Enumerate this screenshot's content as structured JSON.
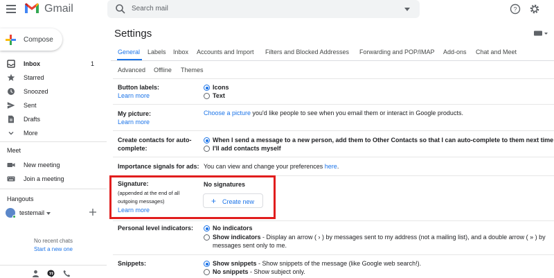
{
  "app": {
    "brand": "Gmail"
  },
  "search": {
    "placeholder": "Search mail"
  },
  "compose": {
    "label": "Compose"
  },
  "sidebar": {
    "items": [
      {
        "label": "Inbox",
        "count": "1",
        "icon": "inbox-icon"
      },
      {
        "label": "Starred",
        "icon": "star-icon"
      },
      {
        "label": "Snoozed",
        "icon": "clock-icon"
      },
      {
        "label": "Sent",
        "icon": "send-icon"
      },
      {
        "label": "Drafts",
        "icon": "draft-icon"
      },
      {
        "label": "More",
        "icon": "chevron-down-icon"
      }
    ],
    "meet_title": "Meet",
    "meet_items": [
      {
        "label": "New meeting",
        "icon": "video-icon"
      },
      {
        "label": "Join a meeting",
        "icon": "keyboard-icon"
      }
    ],
    "hangouts_title": "Hangouts",
    "hangouts_user": "testemail",
    "no_chats": "No recent chats",
    "start_new": "Start a new one"
  },
  "settings": {
    "title": "Settings",
    "tabs_row1": [
      "General",
      "Labels",
      "Inbox",
      "Accounts and Import",
      "Filters and Blocked Addresses",
      "Forwarding and POP/IMAP",
      "Add-ons",
      "Chat and Meet"
    ],
    "tabs_row2": [
      "Advanced",
      "Offline",
      "Themes"
    ],
    "active_tab": "General",
    "rows": {
      "button_labels": {
        "label": "Button labels:",
        "learn": "Learn more",
        "opt1": "Icons",
        "opt2": "Text"
      },
      "my_picture": {
        "label": "My picture:",
        "learn": "Learn more",
        "link": "Choose a picture",
        "text": " you'd like people to see when you email them or interact in Google products."
      },
      "create_contacts": {
        "label1": "Create contacts for auto-",
        "label2": "complete:",
        "opt1": "When I send a message to a new person, add them to Other Contacts so that I can auto-complete to them next time",
        "opt2": "I'll add contacts myself"
      },
      "importance": {
        "label": "Importance signals for ads:",
        "text": "You can view and change your preferences ",
        "link": "here",
        "end": "."
      },
      "signature": {
        "label": "Signature:",
        "sub1": "(appended at the end of all",
        "sub2": "outgoing messages)",
        "learn": "Learn more",
        "none": "No signatures",
        "button": "Create new"
      },
      "personal": {
        "label": "Personal level indicators:",
        "opt1": "No indicators",
        "opt2_bold": "Show indicators",
        "opt2_text": " - Display an arrow ( › ) by messages sent to my address (not a mailing list), and a double arrow ( » ) by",
        "opt2_line2": "messages sent only to me."
      },
      "snippets": {
        "label": "Snippets:",
        "opt1_bold": "Show snippets",
        "opt1_text": " - Show snippets of the message (like Google web search!).",
        "opt2_bold": "No snippets",
        "opt2_text": " - Show subject only."
      }
    }
  },
  "colors": {
    "accent": "#1a73e8",
    "highlight": "#e11d1d"
  }
}
